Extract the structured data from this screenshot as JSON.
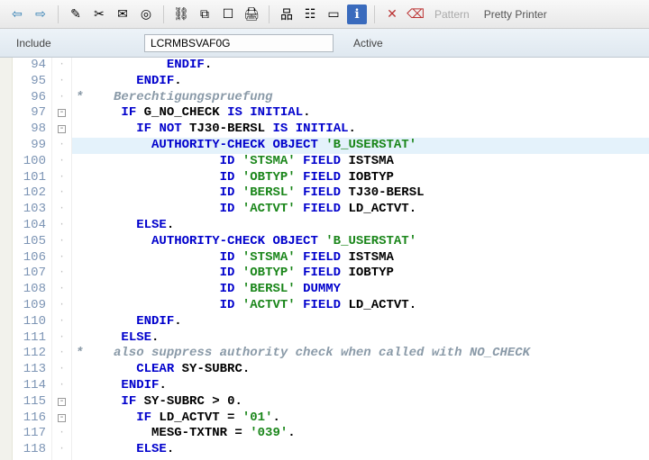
{
  "toolbar": {
    "back_icon": "⇦",
    "forward_icon": "⇨",
    "icons": [
      "✎",
      "✂",
      "✉",
      "◎",
      "⛓",
      "⧉",
      "☐",
      "🖨",
      "品",
      "☷",
      "▭",
      "ℹ",
      "✕",
      "⌫"
    ],
    "pattern_label": "Pattern",
    "pretty_label": "Pretty Printer"
  },
  "include": {
    "label": "Include",
    "value": "LCRMBSVAF0G",
    "status": "Active"
  },
  "lines": [
    {
      "n": 94,
      "fold": "|",
      "hl": false,
      "code": [
        [
          "            ",
          "plain"
        ],
        [
          "ENDIF",
          "kw"
        ],
        [
          ".",
          "punc"
        ]
      ]
    },
    {
      "n": 95,
      "fold": "|",
      "hl": false,
      "code": [
        [
          "        ",
          "plain"
        ],
        [
          "ENDIF",
          "kw"
        ],
        [
          ".",
          "punc"
        ]
      ]
    },
    {
      "n": 96,
      "fold": "|",
      "hl": false,
      "code": [
        [
          "*    Berechtigungspruefung",
          "cmt"
        ]
      ]
    },
    {
      "n": 97,
      "fold": "-",
      "hl": false,
      "code": [
        [
          "      ",
          "plain"
        ],
        [
          "IF",
          "kw"
        ],
        [
          " G_NO_CHECK ",
          "ident"
        ],
        [
          "IS",
          "kw"
        ],
        [
          " ",
          "plain"
        ],
        [
          "INITIAL",
          "kw"
        ],
        [
          ".",
          "punc"
        ]
      ]
    },
    {
      "n": 98,
      "fold": "-",
      "hl": false,
      "code": [
        [
          "        ",
          "plain"
        ],
        [
          "IF",
          "kw"
        ],
        [
          " ",
          "plain"
        ],
        [
          "NOT",
          "kw"
        ],
        [
          " TJ30-BERSL ",
          "ident"
        ],
        [
          "IS",
          "kw"
        ],
        [
          " ",
          "plain"
        ],
        [
          "INITIAL",
          "kw"
        ],
        [
          ".",
          "punc"
        ]
      ]
    },
    {
      "n": 99,
      "fold": "|",
      "hl": true,
      "code": [
        [
          "          ",
          "plain"
        ],
        [
          "AUTHORITY-CHECK",
          "kw"
        ],
        [
          " ",
          "plain"
        ],
        [
          "OBJECT",
          "kw"
        ],
        [
          " ",
          "plain"
        ],
        [
          "'B_USERSTAT'",
          "str"
        ]
      ]
    },
    {
      "n": 100,
      "fold": "|",
      "hl": false,
      "code": [
        [
          "                   ",
          "plain"
        ],
        [
          "ID",
          "kw"
        ],
        [
          " ",
          "plain"
        ],
        [
          "'STSMA'",
          "str"
        ],
        [
          " ",
          "plain"
        ],
        [
          "FIELD",
          "kw"
        ],
        [
          " ISTSMA",
          "ident"
        ]
      ]
    },
    {
      "n": 101,
      "fold": "|",
      "hl": false,
      "code": [
        [
          "                   ",
          "plain"
        ],
        [
          "ID",
          "kw"
        ],
        [
          " ",
          "plain"
        ],
        [
          "'OBTYP'",
          "str"
        ],
        [
          " ",
          "plain"
        ],
        [
          "FIELD",
          "kw"
        ],
        [
          " IOBTYP",
          "ident"
        ]
      ]
    },
    {
      "n": 102,
      "fold": "|",
      "hl": false,
      "code": [
        [
          "                   ",
          "plain"
        ],
        [
          "ID",
          "kw"
        ],
        [
          " ",
          "plain"
        ],
        [
          "'BERSL'",
          "str"
        ],
        [
          " ",
          "plain"
        ],
        [
          "FIELD",
          "kw"
        ],
        [
          " TJ30-BERSL",
          "ident"
        ]
      ]
    },
    {
      "n": 103,
      "fold": "|",
      "hl": false,
      "code": [
        [
          "                   ",
          "plain"
        ],
        [
          "ID",
          "kw"
        ],
        [
          " ",
          "plain"
        ],
        [
          "'ACTVT'",
          "str"
        ],
        [
          " ",
          "plain"
        ],
        [
          "FIELD",
          "kw"
        ],
        [
          " LD_ACTVT",
          "ident"
        ],
        [
          ".",
          "punc"
        ]
      ]
    },
    {
      "n": 104,
      "fold": "|",
      "hl": false,
      "code": [
        [
          "        ",
          "plain"
        ],
        [
          "ELSE",
          "kw"
        ],
        [
          ".",
          "punc"
        ]
      ]
    },
    {
      "n": 105,
      "fold": "|",
      "hl": false,
      "code": [
        [
          "          ",
          "plain"
        ],
        [
          "AUTHORITY-CHECK",
          "kw"
        ],
        [
          " ",
          "plain"
        ],
        [
          "OBJECT",
          "kw"
        ],
        [
          " ",
          "plain"
        ],
        [
          "'B_USERSTAT'",
          "str"
        ]
      ]
    },
    {
      "n": 106,
      "fold": "|",
      "hl": false,
      "code": [
        [
          "                   ",
          "plain"
        ],
        [
          "ID",
          "kw"
        ],
        [
          " ",
          "plain"
        ],
        [
          "'STSMA'",
          "str"
        ],
        [
          " ",
          "plain"
        ],
        [
          "FIELD",
          "kw"
        ],
        [
          " ISTSMA",
          "ident"
        ]
      ]
    },
    {
      "n": 107,
      "fold": "|",
      "hl": false,
      "code": [
        [
          "                   ",
          "plain"
        ],
        [
          "ID",
          "kw"
        ],
        [
          " ",
          "plain"
        ],
        [
          "'OBTYP'",
          "str"
        ],
        [
          " ",
          "plain"
        ],
        [
          "FIELD",
          "kw"
        ],
        [
          " IOBTYP",
          "ident"
        ]
      ]
    },
    {
      "n": 108,
      "fold": "|",
      "hl": false,
      "code": [
        [
          "                   ",
          "plain"
        ],
        [
          "ID",
          "kw"
        ],
        [
          " ",
          "plain"
        ],
        [
          "'BERSL'",
          "str"
        ],
        [
          " ",
          "plain"
        ],
        [
          "DUMMY",
          "kw"
        ]
      ]
    },
    {
      "n": 109,
      "fold": "|",
      "hl": false,
      "code": [
        [
          "                   ",
          "plain"
        ],
        [
          "ID",
          "kw"
        ],
        [
          " ",
          "plain"
        ],
        [
          "'ACTVT'",
          "str"
        ],
        [
          " ",
          "plain"
        ],
        [
          "FIELD",
          "kw"
        ],
        [
          " LD_ACTVT",
          "ident"
        ],
        [
          ".",
          "punc"
        ]
      ]
    },
    {
      "n": 110,
      "fold": "|",
      "hl": false,
      "code": [
        [
          "        ",
          "plain"
        ],
        [
          "ENDIF",
          "kw"
        ],
        [
          ".",
          "punc"
        ]
      ]
    },
    {
      "n": 111,
      "fold": "|",
      "hl": false,
      "code": [
        [
          "      ",
          "plain"
        ],
        [
          "ELSE",
          "kw"
        ],
        [
          ".",
          "punc"
        ]
      ]
    },
    {
      "n": 112,
      "fold": "|",
      "hl": false,
      "code": [
        [
          "*    also suppress authority check when called with NO_CHECK",
          "cmt"
        ]
      ]
    },
    {
      "n": 113,
      "fold": "|",
      "hl": false,
      "code": [
        [
          "        ",
          "plain"
        ],
        [
          "CLEAR",
          "kw"
        ],
        [
          " SY-SUBRC",
          "ident"
        ],
        [
          ".",
          "punc"
        ]
      ]
    },
    {
      "n": 114,
      "fold": "|",
      "hl": false,
      "code": [
        [
          "      ",
          "plain"
        ],
        [
          "ENDIF",
          "kw"
        ],
        [
          ".",
          "punc"
        ]
      ]
    },
    {
      "n": 115,
      "fold": "-",
      "hl": false,
      "code": [
        [
          "      ",
          "plain"
        ],
        [
          "IF",
          "kw"
        ],
        [
          " SY-SUBRC > ",
          "ident"
        ],
        [
          "0",
          "plain"
        ],
        [
          ".",
          "punc"
        ]
      ]
    },
    {
      "n": 116,
      "fold": "-",
      "hl": false,
      "code": [
        [
          "        ",
          "plain"
        ],
        [
          "IF",
          "kw"
        ],
        [
          " LD_ACTVT = ",
          "ident"
        ],
        [
          "'01'",
          "str"
        ],
        [
          ".",
          "punc"
        ]
      ]
    },
    {
      "n": 117,
      "fold": "|",
      "hl": false,
      "code": [
        [
          "          MESG-TXTNR = ",
          "ident"
        ],
        [
          "'039'",
          "str"
        ],
        [
          ".",
          "punc"
        ]
      ]
    },
    {
      "n": 118,
      "fold": "|",
      "hl": false,
      "code": [
        [
          "        ",
          "plain"
        ],
        [
          "ELSE",
          "kw"
        ],
        [
          ".",
          "punc"
        ]
      ]
    }
  ]
}
